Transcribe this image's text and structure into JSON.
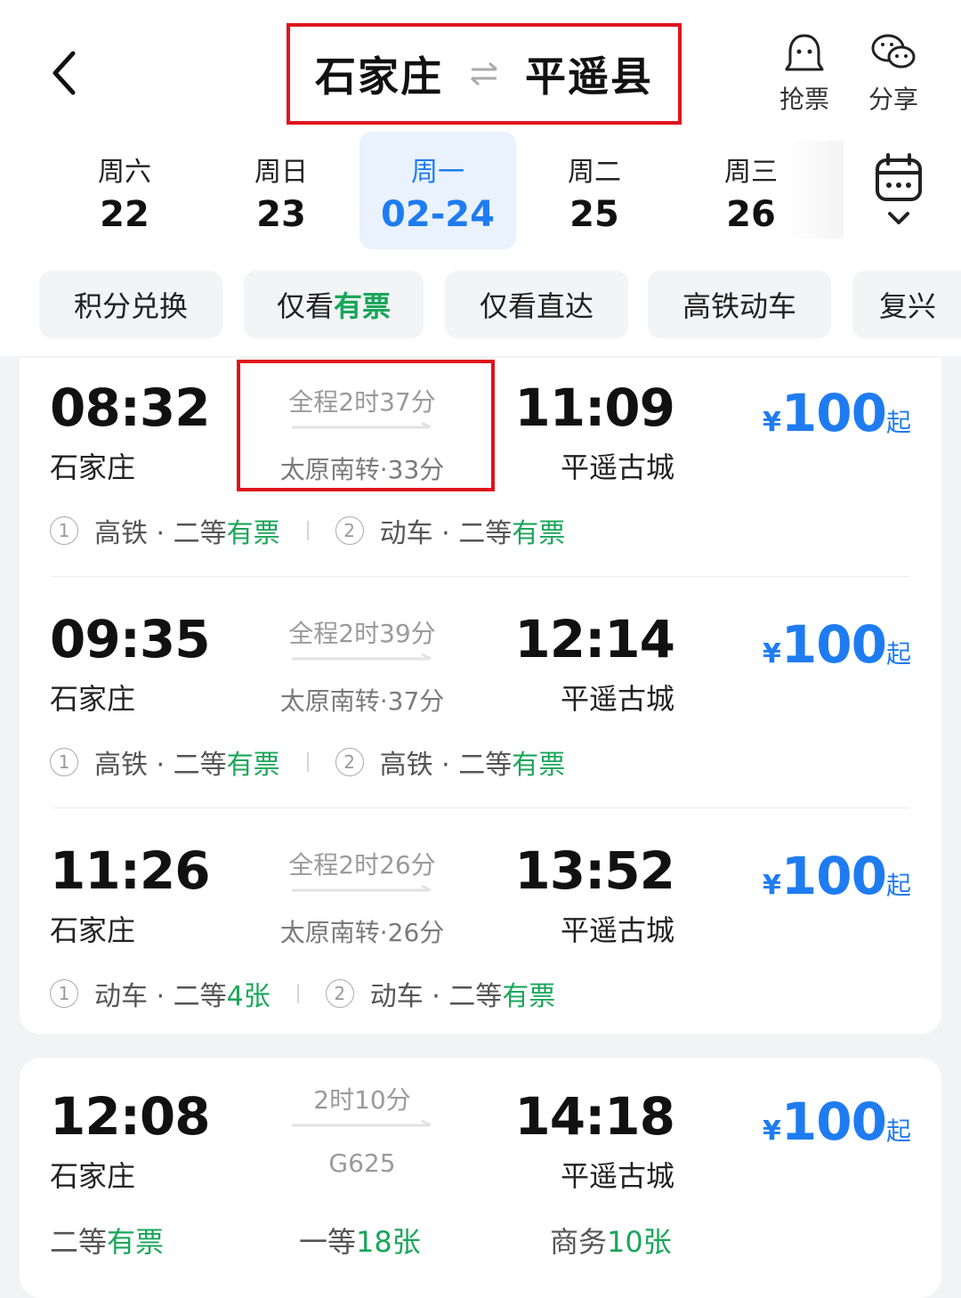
{
  "header": {
    "from_city": "石家庄",
    "to_city": "平遥县",
    "grab_label": "抢票",
    "share_label": "分享"
  },
  "dates": [
    {
      "weekday": "周六",
      "date": "22"
    },
    {
      "weekday": "周日",
      "date": "23"
    },
    {
      "weekday": "周一",
      "date": "02-24",
      "selected": true
    },
    {
      "weekday": "周二",
      "date": "25"
    },
    {
      "weekday": "周三",
      "date": "26"
    }
  ],
  "filters": {
    "points": "积分兑换",
    "only_available_prefix": "仅看",
    "only_available_highlight": "有票",
    "direct_only": "仅看直达",
    "high_speed": "高铁动车",
    "fuxing": "复兴"
  },
  "trains": [
    {
      "dep_time": "08:32",
      "dep_station": "石家庄",
      "duration": "全程2时37分",
      "transfer": "太原南转·33分",
      "arr_time": "11:09",
      "arr_station": "平遥古城",
      "price_symbol": "¥",
      "price": "100",
      "price_suffix": "起",
      "seg1_no": "1",
      "seg1_type": "高铁 · 二等",
      "seg1_status": "有票",
      "seg2_no": "2",
      "seg2_type": "动车 · 二等",
      "seg2_status": "有票"
    },
    {
      "dep_time": "09:35",
      "dep_station": "石家庄",
      "duration": "全程2时39分",
      "transfer": "太原南转·37分",
      "arr_time": "12:14",
      "arr_station": "平遥古城",
      "price_symbol": "¥",
      "price": "100",
      "price_suffix": "起",
      "seg1_no": "1",
      "seg1_type": "高铁 · 二等",
      "seg1_status": "有票",
      "seg2_no": "2",
      "seg2_type": "高铁 · 二等",
      "seg2_status": "有票"
    },
    {
      "dep_time": "11:26",
      "dep_station": "石家庄",
      "duration": "全程2时26分",
      "transfer": "太原南转·26分",
      "arr_time": "13:52",
      "arr_station": "平遥古城",
      "price_symbol": "¥",
      "price": "100",
      "price_suffix": "起",
      "seg1_no": "1",
      "seg1_type": "动车 · 二等",
      "seg1_status": "4张",
      "seg2_no": "2",
      "seg2_type": "动车 · 二等",
      "seg2_status": "有票"
    },
    {
      "dep_time": "12:08",
      "dep_station": "石家庄",
      "duration": "2时10分",
      "train_no": "G625",
      "arr_time": "14:18",
      "arr_station": "平遥古城",
      "price_symbol": "¥",
      "price": "100",
      "price_suffix": "起",
      "second_class": "二等",
      "second_status": "有票",
      "first_class": "一等",
      "first_status": "18张",
      "business_class": "商务",
      "business_status": "10张"
    }
  ],
  "colors": {
    "accent": "#1f7cf0",
    "available": "#19a65a",
    "highlight_box": "#e0131c",
    "selected_date_bg": "#e9f2fd"
  }
}
